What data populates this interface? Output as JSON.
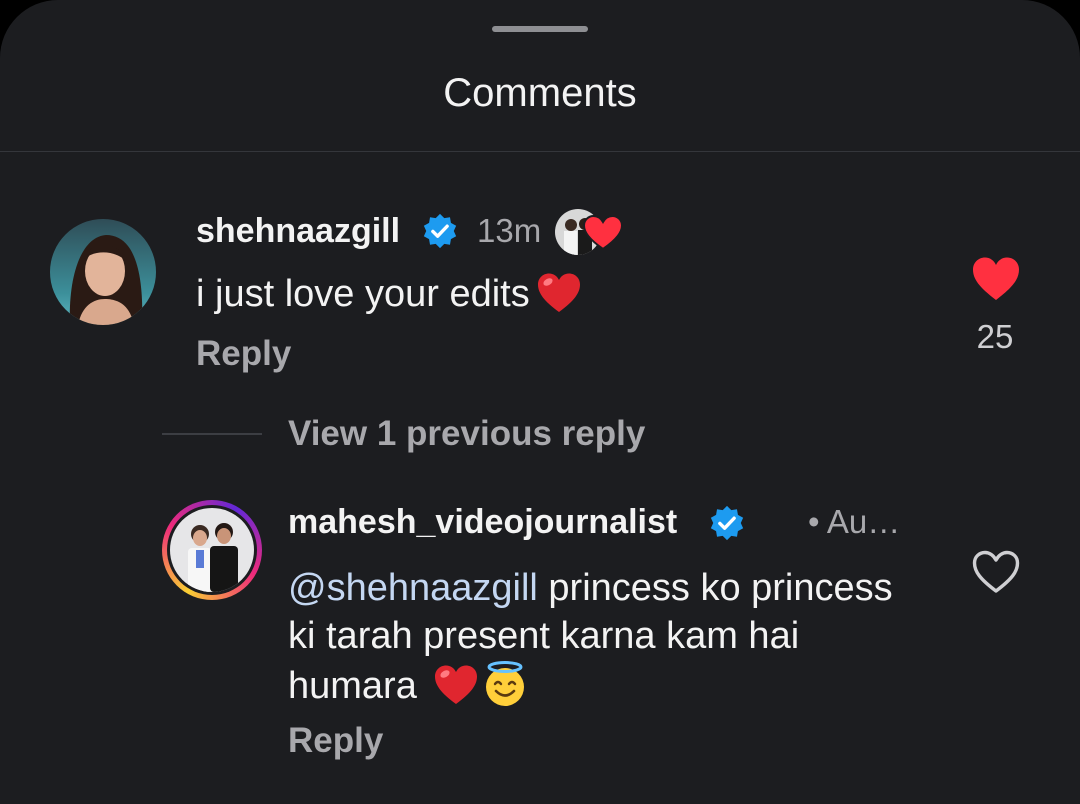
{
  "sheet": {
    "title": "Comments"
  },
  "comments": [
    {
      "username": "shehnaazgill",
      "verified": true,
      "time": "13m",
      "text": "i just love your edits",
      "emoji": "red-heart-emoji",
      "reply_label": "Reply",
      "liked": true,
      "like_count": "25",
      "liked_by_creator": true
    }
  ],
  "thread": {
    "view_replies_label": "View 1 previous reply"
  },
  "replies": [
    {
      "username": "mahesh_videojournalist",
      "verified": true,
      "time": "• Au…",
      "mention": "@shehnaazgill",
      "text": " princess ko princess ki tarah present karna kam hai humara ",
      "emojis": [
        "red-heart-emoji",
        "smiling-face-with-halo-emoji"
      ],
      "reply_label": "Reply",
      "liked": false,
      "story_ring": true
    }
  ],
  "colors": {
    "background": "#1c1d20",
    "text_primary": "#f3f3f3",
    "text_secondary": "#a8a8ac",
    "verified_blue": "#1d9bf0",
    "like_red": "#ff3040",
    "mention": "#c4d7f2"
  }
}
